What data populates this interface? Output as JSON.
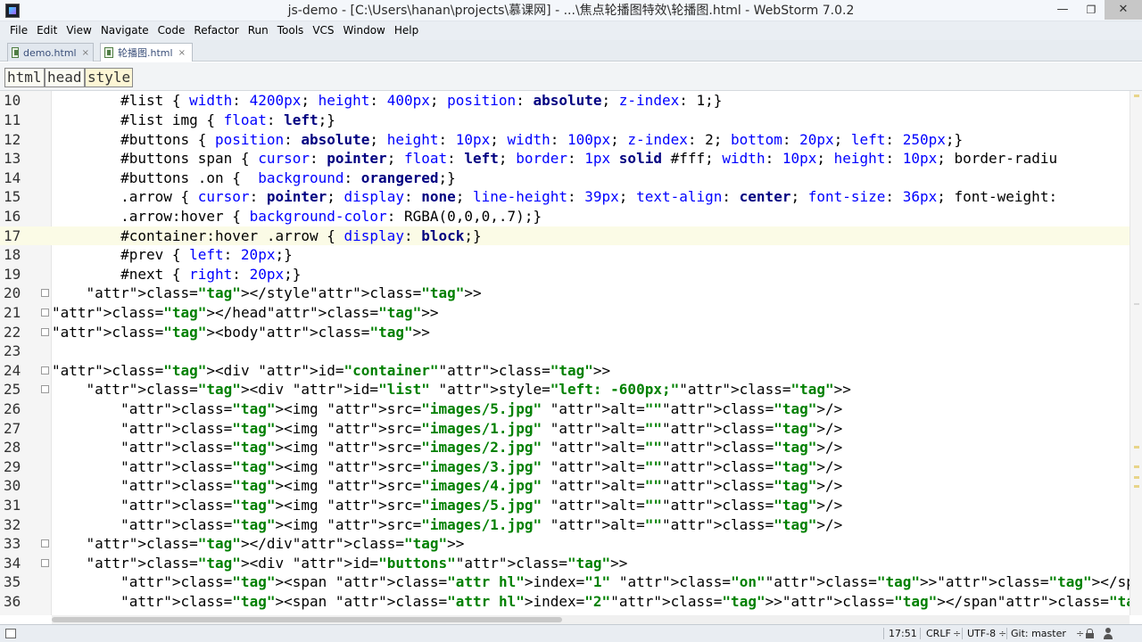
{
  "window": {
    "title": "js-demo - [C:\\Users\\hanan\\projects\\慕课网] - ...\\焦点轮播图特效\\轮播图.html - WebStorm 7.0.2",
    "min_glyph": "—",
    "max_glyph": "❐",
    "close_glyph": "✕"
  },
  "menu": [
    "File",
    "Edit",
    "View",
    "Navigate",
    "Code",
    "Refactor",
    "Run",
    "Tools",
    "VCS",
    "Window",
    "Help"
  ],
  "tabs": [
    {
      "label": "demo.html",
      "active": false
    },
    {
      "label": "轮播图.html",
      "active": true
    }
  ],
  "tab_close_glyph": "×",
  "breadcrumb": [
    "html",
    "head",
    "style"
  ],
  "editor": {
    "current_line": "17",
    "lines": [
      {
        "n": "10",
        "text": "        #list { width: 4200px; height: 400px; position: absolute; z-index: 1;}"
      },
      {
        "n": "11",
        "text": "        #list img { float: left;}"
      },
      {
        "n": "12",
        "text": "        #buttons { position: absolute; height: 10px; width: 100px; z-index: 2; bottom: 20px; left: 250px;}"
      },
      {
        "n": "13",
        "text": "        #buttons span { cursor: pointer; float: left; border: 1px solid #fff; width: 10px; height: 10px; border-radiu"
      },
      {
        "n": "14",
        "text": "        #buttons .on {  background: orangered;}"
      },
      {
        "n": "15",
        "text": "        .arrow { cursor: pointer; display: none; line-height: 39px; text-align: center; font-size: 36px; font-weight:"
      },
      {
        "n": "16",
        "text": "        .arrow:hover { background-color: RGBA(0,0,0,.7);}"
      },
      {
        "n": "17",
        "text": "        #container:hover .arrow { display: block;}"
      },
      {
        "n": "18",
        "text": "        #prev { left: 20px;}"
      },
      {
        "n": "19",
        "text": "        #next { right: 20px;}"
      },
      {
        "n": "20",
        "text": "    </style>"
      },
      {
        "n": "21",
        "text": "</head>"
      },
      {
        "n": "22",
        "text": "<body>"
      },
      {
        "n": "23",
        "text": ""
      },
      {
        "n": "24",
        "text": "<div id=\"container\">"
      },
      {
        "n": "25",
        "text": "    <div id=\"list\" style=\"left: -600px;\">"
      },
      {
        "n": "26",
        "text": "        <img src=\"images/5.jpg\" alt=\"\"/>"
      },
      {
        "n": "27",
        "text": "        <img src=\"images/1.jpg\" alt=\"\"/>"
      },
      {
        "n": "28",
        "text": "        <img src=\"images/2.jpg\" alt=\"\"/>"
      },
      {
        "n": "29",
        "text": "        <img src=\"images/3.jpg\" alt=\"\"/>"
      },
      {
        "n": "30",
        "text": "        <img src=\"images/4.jpg\" alt=\"\"/>"
      },
      {
        "n": "31",
        "text": "        <img src=\"images/5.jpg\" alt=\"\"/>"
      },
      {
        "n": "32",
        "text": "        <img src=\"images/1.jpg\" alt=\"\"/>"
      },
      {
        "n": "33",
        "text": "    </div>"
      },
      {
        "n": "34",
        "text": "    <div id=\"buttons\">"
      },
      {
        "n": "35",
        "text": "        <span index=\"1\" class=\"on\"></span>"
      },
      {
        "n": "36",
        "text": "        <span index=\"2\"></span>"
      }
    ]
  },
  "status": {
    "position": "17:51",
    "line_separator": "CRLF",
    "line_separator_arrow": "÷",
    "encoding": "UTF-8",
    "encoding_arrow": "÷",
    "vcs": "Git: master",
    "vcs_arrow": "÷"
  },
  "colors": {
    "current_line_bg": "#fbfbe6",
    "tag": "#000080",
    "attr": "#0000ff",
    "string": "#008000"
  }
}
